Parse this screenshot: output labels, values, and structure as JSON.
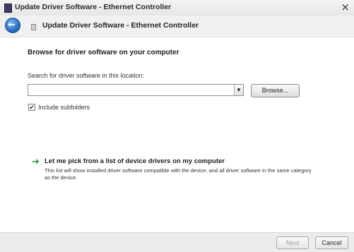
{
  "window": {
    "title": "Update Driver Software - Ethernet Controller",
    "close_glyph": "×"
  },
  "header": {
    "back_glyph": "←",
    "title": "Update Driver Software - Ethernet Controller"
  },
  "content": {
    "heading": "Browse for driver software on your computer",
    "search_label": "Search for driver software in this location:",
    "path_value": "",
    "browse_label": "Browse...",
    "include_subfolders_label": "Include subfolders",
    "include_subfolders_checked": true,
    "checkbox_glyph": "✔",
    "pick_option": {
      "icon": "green-arrow-icon",
      "arrow_glyph": "➜",
      "title": "Let me pick from a list of device drivers on my computer",
      "description": "This list will show installed driver software compatible with the device, and all driver software in the same category as the device."
    }
  },
  "footer": {
    "next_label": "Next",
    "cancel_label": "Cancel"
  },
  "colors": {
    "accent": "#1e63b8",
    "arrow_green": "#2e9a2e"
  }
}
